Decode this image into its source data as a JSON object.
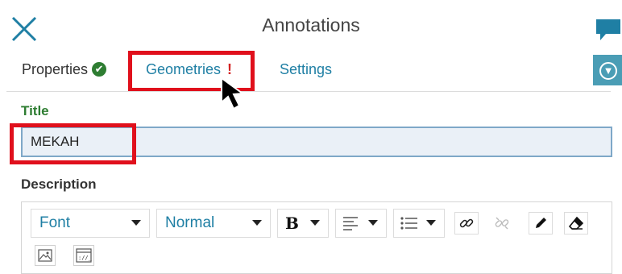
{
  "header": {
    "title": "Annotations"
  },
  "tabs": {
    "properties": "Properties",
    "geometries": "Geometries",
    "geometries_flag": "!",
    "settings": "Settings"
  },
  "form": {
    "title_label": "Title",
    "title_value": "MEKAH",
    "description_label": "Description"
  },
  "toolbar": {
    "font_select": "Font",
    "size_select": "Normal",
    "bold_glyph": "B"
  },
  "colors": {
    "accent": "#1f7fa4",
    "valid_green": "#2e7d32",
    "highlight_red": "#e0101c",
    "collapse_button": "#4a9db5"
  }
}
